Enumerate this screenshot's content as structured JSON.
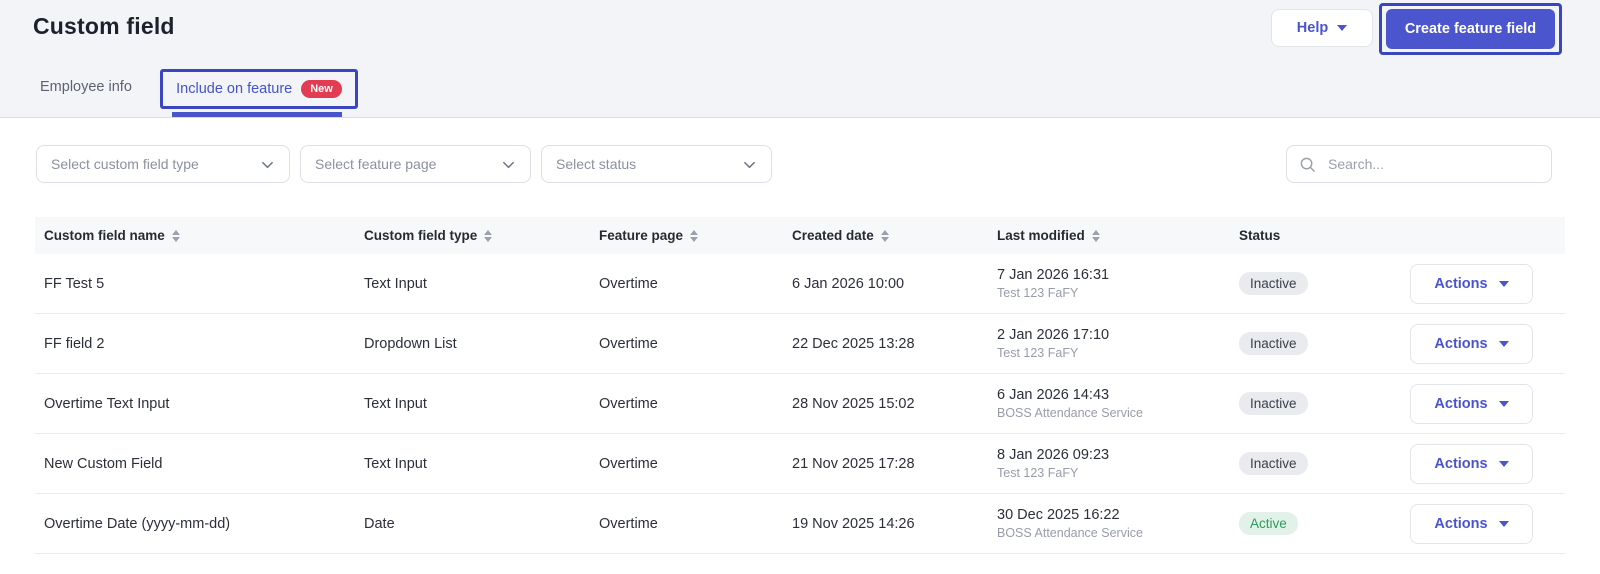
{
  "header": {
    "title": "Custom field",
    "help_label": "Help",
    "create_button_label": "Create feature field"
  },
  "tabs": {
    "employee_info": "Employee info",
    "include_on_feature": "Include on feature",
    "new_badge": "New"
  },
  "filters": {
    "field_type_placeholder": "Select custom field type",
    "feature_page_placeholder": "Select feature page",
    "status_placeholder": "Select status"
  },
  "search": {
    "placeholder": "Search..."
  },
  "table": {
    "columns": [
      {
        "label": "Custom field name",
        "sortable": true
      },
      {
        "label": "Custom field type",
        "sortable": true
      },
      {
        "label": "Feature page",
        "sortable": true
      },
      {
        "label": "Created date",
        "sortable": true
      },
      {
        "label": "Last modified",
        "sortable": true
      },
      {
        "label": "Status",
        "sortable": false
      }
    ],
    "actions_label": "Actions",
    "rows": [
      {
        "name": "FF Test 5",
        "type": "Text Input",
        "feature_page": "Overtime",
        "created": "6 Jan 2026 10:00",
        "modified": "7 Jan 2026 16:31",
        "modified_by": "Test 123 FaFY",
        "status": "Inactive"
      },
      {
        "name": "FF field 2",
        "type": "Dropdown List",
        "feature_page": "Overtime",
        "created": "22 Dec 2025 13:28",
        "modified": "2 Jan 2026 17:10",
        "modified_by": "Test 123 FaFY",
        "status": "Inactive"
      },
      {
        "name": "Overtime Text Input",
        "type": "Text Input",
        "feature_page": "Overtime",
        "created": "28 Nov 2025 15:02",
        "modified": "6 Jan 2026 14:43",
        "modified_by": "BOSS Attendance Service",
        "status": "Inactive"
      },
      {
        "name": "New Custom Field",
        "type": "Text Input",
        "feature_page": "Overtime",
        "created": "21 Nov 2025 17:28",
        "modified": "8 Jan 2026 09:23",
        "modified_by": "Test 123 FaFY",
        "status": "Inactive"
      },
      {
        "name": "Overtime Date (yyyy-mm-dd)",
        "type": "Date",
        "feature_page": "Overtime",
        "created": "19 Nov 2025 14:26",
        "modified": "30 Dec 2025 16:22",
        "modified_by": "BOSS Attendance Service",
        "status": "Active"
      }
    ]
  },
  "colors": {
    "accent_indigo": "#4B55CD",
    "annotation_outline": "#3A45C0",
    "new_badge_red": "#E23C53",
    "active_green": "#2E9C5C",
    "inactive_gray": "#E9EBEE"
  }
}
